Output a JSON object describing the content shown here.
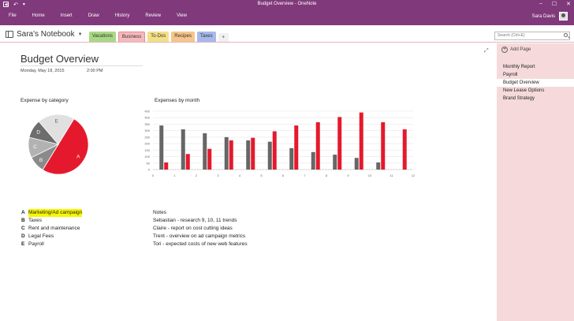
{
  "window": {
    "title": "Budget Overview - OneNote",
    "min": "–",
    "max": "☐",
    "close": "✕"
  },
  "quick_access": {
    "back": "◀",
    "undo": "↶",
    "dock": "▾"
  },
  "ribbon": {
    "tabs": [
      "File",
      "Home",
      "Insert",
      "Draw",
      "History",
      "Review",
      "View"
    ]
  },
  "user": {
    "name": "Sara Davis"
  },
  "notebook": {
    "name": "Sara's Notebook",
    "dropdown": "▼"
  },
  "sections": [
    {
      "label": "Vacations",
      "color": "#a9d884"
    },
    {
      "label": "Business",
      "color": "#f5b9bd"
    },
    {
      "label": "To-Dos",
      "color": "#f3df86"
    },
    {
      "label": "Recipes",
      "color": "#f7c58a"
    },
    {
      "label": "Taxes",
      "color": "#a8b8ec"
    }
  ],
  "add_section": "+",
  "search": {
    "placeholder": "Search (Ctrl+E)"
  },
  "expand_icon": "⤢",
  "page": {
    "title": "Budget Overview",
    "date": "Monday, May 18, 2015",
    "time": "2:00 PM"
  },
  "pie": {
    "title": "Expense by category",
    "slices": [
      {
        "key": "A",
        "share": 0.5,
        "color": "#e5192d"
      },
      {
        "key": "B",
        "share": 0.09,
        "color": "#8a8a8a"
      },
      {
        "key": "C",
        "share": 0.11,
        "color": "#b2b2b2"
      },
      {
        "key": "D",
        "share": 0.1,
        "color": "#6d6d6d"
      },
      {
        "key": "E",
        "share": 0.2,
        "color": "#e0e0e0"
      }
    ]
  },
  "legend": [
    {
      "key": "A",
      "label": "Marketing/Ad campaign",
      "highlight": true
    },
    {
      "key": "B",
      "label": "Taxes",
      "highlight": false
    },
    {
      "key": "C",
      "label": "Rent and maintenance",
      "highlight": false
    },
    {
      "key": "D",
      "label": "Legal Fees",
      "highlight": false
    },
    {
      "key": "E",
      "label": "Payroll",
      "highlight": false
    }
  ],
  "chart_data": {
    "type": "bar",
    "title": "Expenses by month",
    "categories": [
      "1",
      "2",
      "3",
      "4",
      "5",
      "6",
      "7",
      "8",
      "9",
      "10",
      "11",
      "12"
    ],
    "x_ticks": [
      "0",
      "1",
      "2",
      "3",
      "4",
      "5",
      "6",
      "7",
      "8",
      "9",
      "10",
      "11",
      "12"
    ],
    "y_ticks": [
      "0",
      "50",
      "100",
      "150",
      "200",
      "250",
      "300",
      "350",
      "400",
      "450"
    ],
    "ylim": [
      0,
      450
    ],
    "series": [
      {
        "name": "",
        "color": "#666666",
        "values": [
          340,
          310,
          280,
          250,
          225,
          215,
          165,
          135,
          115,
          90,
          55,
          0
        ]
      },
      {
        "name": "",
        "color": "#e5192d",
        "values": [
          55,
          120,
          160,
          225,
          245,
          295,
          340,
          365,
          405,
          440,
          365,
          310
        ]
      }
    ]
  },
  "notes": {
    "heading": "Notes",
    "lines": [
      "Sebastian - research 9, 10, 11 trends",
      "Claire - report on cost cutting ideas",
      "Trent - overview on ad campaign metrics",
      "Tori - expected costs of new web features"
    ]
  },
  "pagelist": {
    "add_label": "Add Page",
    "items": [
      "Monthly Report",
      "Payroll",
      "Budget Overview",
      "New Lease Options",
      "Brand Strategy"
    ],
    "active_index": 2
  }
}
